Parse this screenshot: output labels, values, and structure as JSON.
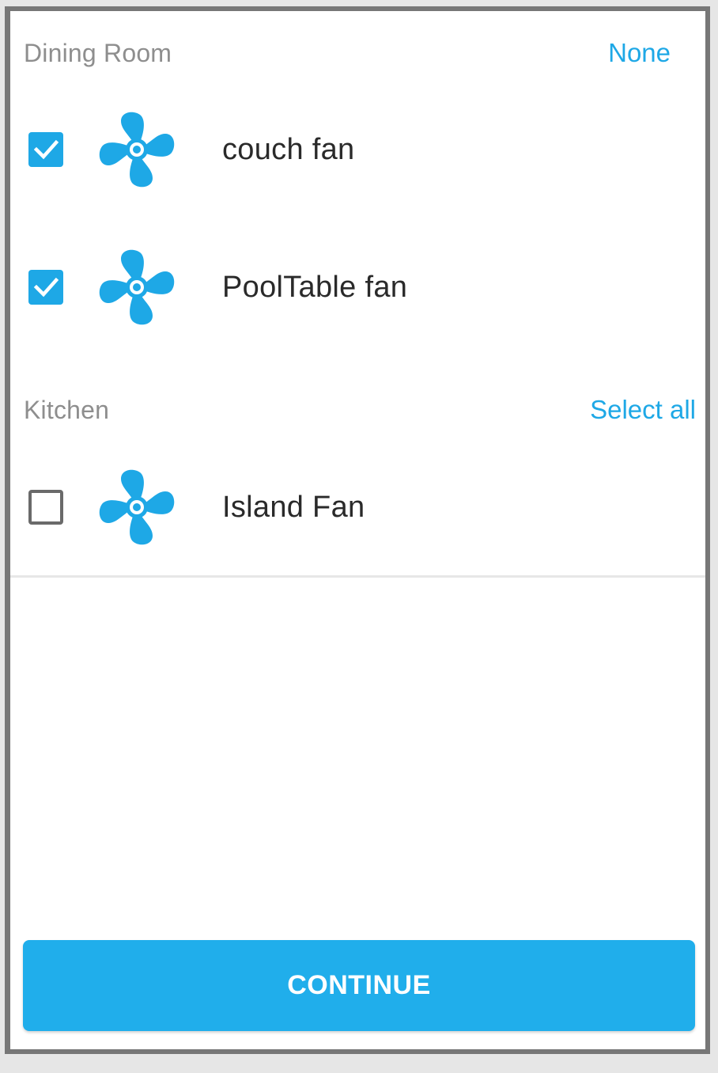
{
  "sections": [
    {
      "title": "Dining Room",
      "action": "None",
      "devices": [
        {
          "name": "couch fan",
          "checked": true,
          "icon": "fan-icon"
        },
        {
          "name": "PoolTable fan",
          "checked": true,
          "icon": "fan-icon"
        }
      ]
    },
    {
      "title": "Kitchen",
      "action": "Select all",
      "devices": [
        {
          "name": "Island Fan",
          "checked": false,
          "icon": "fan-icon"
        }
      ]
    }
  ],
  "continue_label": "CONTINUE",
  "colors": {
    "accent": "#1ea8e6",
    "button": "#20aeeb",
    "section_title": "#8e8e8e",
    "frame_border": "#777777"
  }
}
